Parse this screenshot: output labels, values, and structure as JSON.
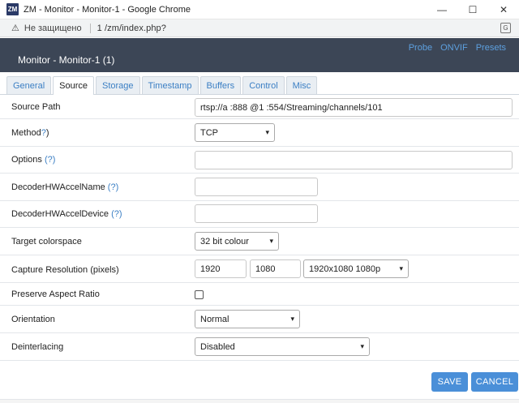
{
  "browser": {
    "window_title": "ZM - Monitor - Monitor-1 - Google Chrome",
    "logo_text": "ZM",
    "not_secure": "Не защищено",
    "url": "1           /zm/index.php?",
    "controls": {
      "minimize": "—",
      "maximize": "☐",
      "close": "✕"
    },
    "warning_glyph": "⚠",
    "translate_glyph": "G"
  },
  "dialog": {
    "title": "Monitor - Monitor-1 (1)",
    "links": [
      "Probe",
      "ONVIF",
      "Presets"
    ]
  },
  "tabs": [
    {
      "label": "General",
      "active": false
    },
    {
      "label": "Source",
      "active": true
    },
    {
      "label": "Storage",
      "active": false
    },
    {
      "label": "Timestamp",
      "active": false
    },
    {
      "label": "Buffers",
      "active": false
    },
    {
      "label": "Control",
      "active": false
    },
    {
      "label": "Misc",
      "active": false
    }
  ],
  "form": {
    "source_path": {
      "label": "Source Path",
      "value": "rtsp://a        :888          @1               :554/Streaming/channels/101"
    },
    "method": {
      "label": "Method",
      "help": "?",
      "suffix": ")",
      "value": "TCP"
    },
    "options": {
      "label": "Options ",
      "help": "(?)",
      "value": ""
    },
    "decoder_hw_accel_name": {
      "label": "DecoderHWAccelName ",
      "help": "(?)",
      "value": ""
    },
    "decoder_hw_accel_device": {
      "label": "DecoderHWAccelDevice ",
      "help": "(?)",
      "value": ""
    },
    "target_colorspace": {
      "label": "Target colorspace",
      "value": "32 bit colour"
    },
    "capture_resolution": {
      "label": "Capture Resolution (pixels)",
      "width": "1920",
      "height": "1080",
      "preset": "1920x1080 1080p"
    },
    "preserve_aspect_ratio": {
      "label": "Preserve Aspect Ratio",
      "checked": false
    },
    "orientation": {
      "label": "Orientation",
      "value": "Normal"
    },
    "deinterlacing": {
      "label": "Deinterlacing",
      "value": "Disabled"
    }
  },
  "buttons": {
    "save": "SAVE",
    "cancel": "CANCEL"
  },
  "colors": {
    "header_bg": "#3c4656",
    "link": "#5da0df",
    "button": "#4a8fd8"
  }
}
